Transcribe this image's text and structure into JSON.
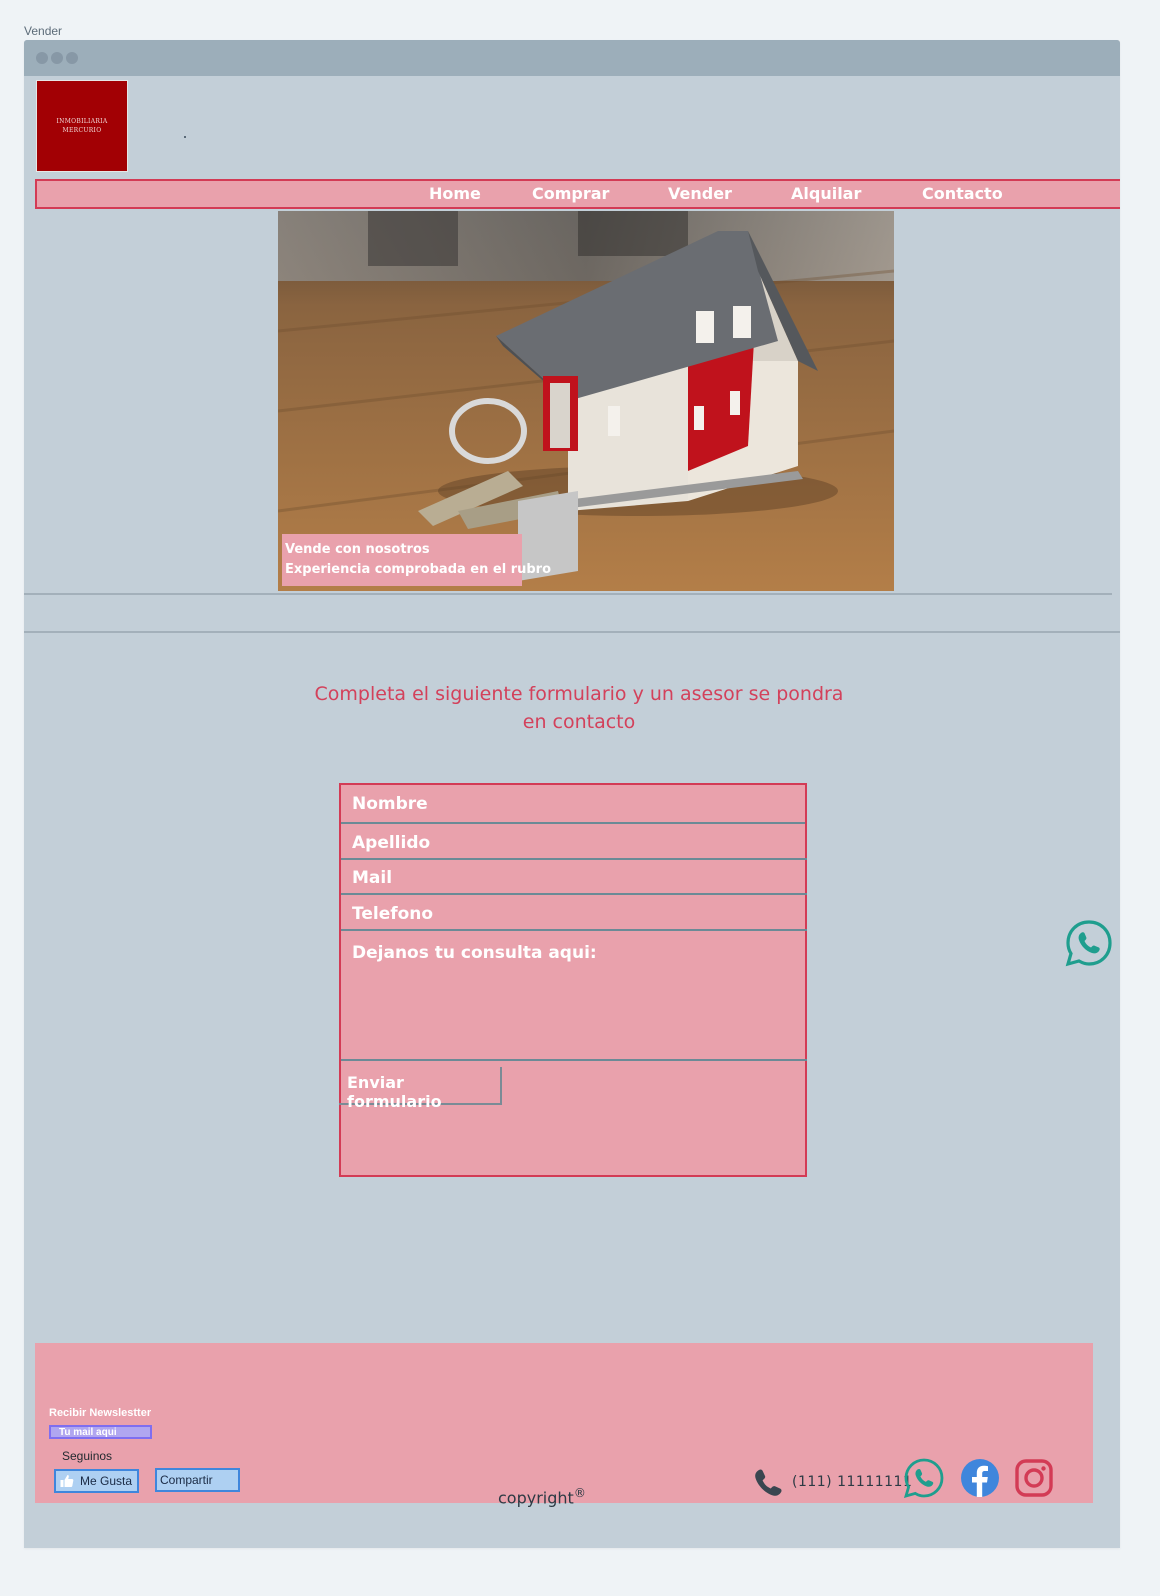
{
  "page": {
    "label": "Vender"
  },
  "logo": {
    "line1": "INMOBILIARIA",
    "line2": "MERCURIO"
  },
  "nav": {
    "items": [
      {
        "label": "Home"
      },
      {
        "label": "Comprar"
      },
      {
        "label": "Vender"
      },
      {
        "label": "Alquilar"
      },
      {
        "label": "Contacto"
      }
    ]
  },
  "hero": {
    "caption_line1": "Vende con nosotros",
    "caption_line2": "Experiencia comprobada en el rubro"
  },
  "form": {
    "heading": "Completa el siguiente formulario y un asesor se pondra en contacto",
    "nombre_placeholder": "Nombre",
    "apellido_placeholder": "Apellido",
    "mail_placeholder": "Mail",
    "telefono_placeholder": "Telefono",
    "consulta_placeholder": "Dejanos tu consulta aqui:",
    "submit_label": "Enviar formulario"
  },
  "footer": {
    "newsletter_label": "Recibir Newslestter",
    "newsletter_placeholder": "Tu mail aqui",
    "follow_label": "Seguinos",
    "like_label": "Me Gusta",
    "share_label": "Compartir",
    "phone": "(111) 11111111",
    "copyright": "copyright",
    "copyright_mark": "®"
  },
  "colors": {
    "accent_pink": "#e9a1ac",
    "accent_red": "#d33b55",
    "background": "#c3cfd8",
    "whatsapp": "#1f9e8e",
    "facebook": "#3f86dc",
    "instagram": "#d33b55"
  },
  "icons": {
    "whatsapp": "whatsapp-icon",
    "facebook": "facebook-icon",
    "instagram": "instagram-icon",
    "phone": "phone-icon",
    "thumb": "thumbs-up-icon"
  }
}
